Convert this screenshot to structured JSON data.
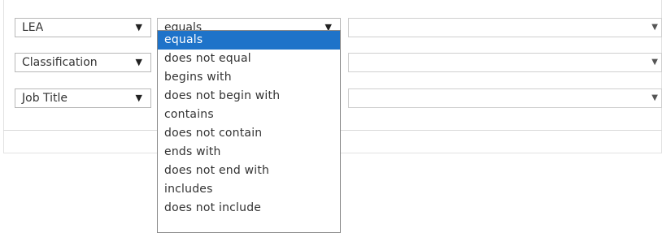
{
  "filters": [
    {
      "field": "LEA",
      "value": ""
    },
    {
      "field": "Classification",
      "value": ""
    },
    {
      "field": "Job Title",
      "value": ""
    }
  ],
  "operator": {
    "selected": "equals",
    "options": [
      "equals",
      "does not equal",
      "begins with",
      "does not begin with",
      "contains",
      "does not contain",
      "ends with",
      "does not end with",
      "includes",
      "does not include"
    ]
  },
  "icons": {
    "field_caret": "▼",
    "value_caret": "▼"
  },
  "colors": {
    "highlight": "#1e73c9",
    "highlight_text": "#ffffff"
  }
}
